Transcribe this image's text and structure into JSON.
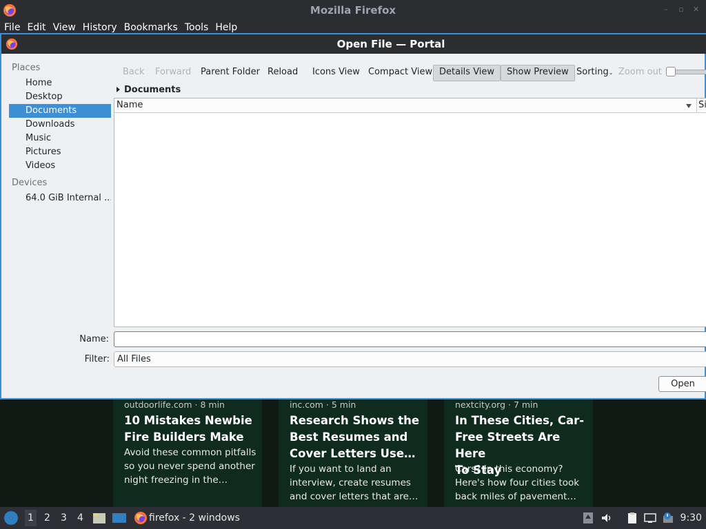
{
  "firefox": {
    "window_title": "Mozilla Firefox",
    "menu": [
      "File",
      "Edit",
      "View",
      "History",
      "Bookmarks",
      "Tools",
      "Help"
    ]
  },
  "dialog": {
    "title": "Open File — Portal",
    "sidebar": {
      "places_heading": "Places",
      "places": [
        "Home",
        "Desktop",
        "Documents",
        "Downloads",
        "Music",
        "Pictures",
        "Videos"
      ],
      "selected": "Documents",
      "devices_heading": "Devices",
      "devices": [
        "64.0 GiB Internal ..."
      ]
    },
    "toolbar": {
      "back": "Back",
      "forward": "Forward",
      "parent_folder": "Parent Folder",
      "reload": "Reload",
      "icons_view": "Icons View",
      "compact_view": "Compact View",
      "details_view": "Details View",
      "show_preview": "Show Preview",
      "sorting": "Sorting",
      "zoom_out": "Zoom out"
    },
    "breadcrumb": "Documents",
    "columns": {
      "name": "Name",
      "size": "Si"
    },
    "name_label": "Name:",
    "name_value": "",
    "filter_label": "Filter:",
    "filter_value": "All Files",
    "open_button": "Open"
  },
  "newtab_cards": [
    {
      "source": "outdoorlife.com · 8 min",
      "headline_lines": [
        "10 Mistakes Newbie",
        "Fire Builders Make"
      ],
      "desc_lines": [
        "Avoid these common pitfalls",
        "so you never spend another",
        "night freezing in the…"
      ]
    },
    {
      "source": "inc.com · 5 min",
      "headline_lines": [
        "Research Shows the",
        "Best Resumes and",
        "Cover Letters Use…"
      ],
      "desc_lines": [
        "If you want to land an",
        "interview, create resumes",
        "and cover letters that are…"
      ]
    },
    {
      "source": "nextcity.org · 7 min",
      "headline_lines": [
        "In These Cities, Car-",
        "Free Streets Are Here",
        "To Stay"
      ],
      "desc_lines": [
        "Cars? In this economy?",
        "Here's how four cities took",
        "back miles of pavement…"
      ]
    }
  ],
  "taskbar": {
    "workspaces": [
      "1",
      "2",
      "3",
      "4"
    ],
    "active_workspace": "1",
    "task_label": "firefox - 2 windows",
    "clock": "9:30"
  },
  "colors": {
    "accent": "#3d8fd6",
    "titlebar": "#2b2d31",
    "card_bg": "#0f2a1e"
  }
}
